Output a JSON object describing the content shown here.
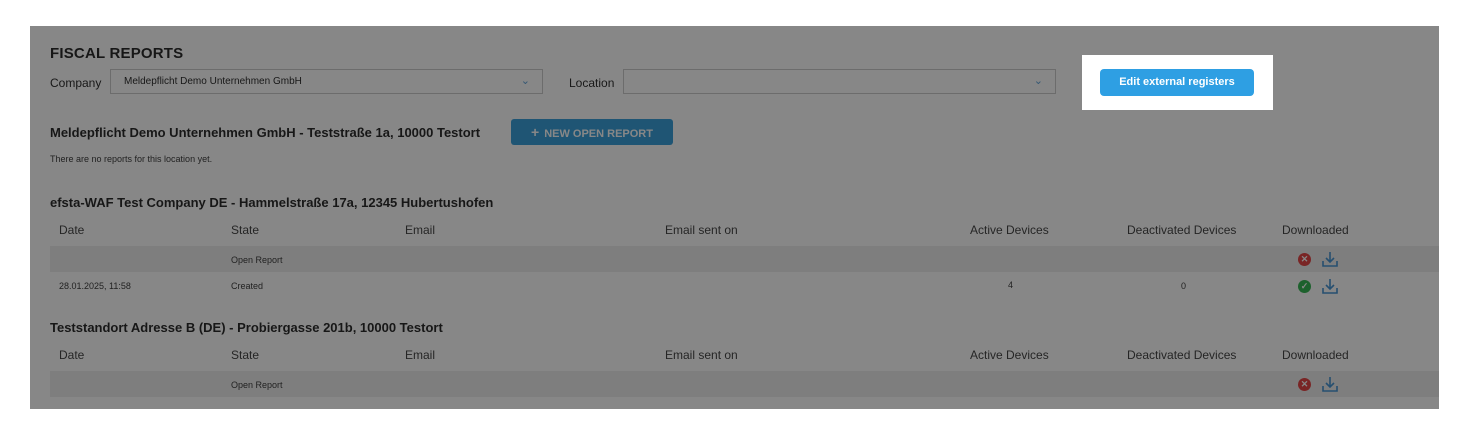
{
  "page": {
    "title": "FISCAL REPORTS"
  },
  "filters": {
    "company_label": "Company",
    "company_value": "Meldepflicht Demo Unternehmen GmbH",
    "location_label": "Location",
    "location_value": "",
    "edit_button": "Edit external registers"
  },
  "sections": [
    {
      "heading": "Meldepflicht Demo Unternehmen GmbH - Teststraße 1a, 10000 Testort",
      "new_button": "NEW OPEN REPORT",
      "empty_text": "There are no reports for this location yet."
    },
    {
      "heading": "efsta-WAF Test Company DE - Hammelstraße 17a, 12345 Hubertushofen",
      "columns": [
        "Date",
        "State",
        "Email",
        "Email sent on",
        "Active Devices",
        "Deactivated Devices",
        "Downloaded"
      ],
      "rows": [
        {
          "date": "",
          "state": "Open Report",
          "email": "",
          "email_sent_on": "",
          "active": "",
          "deactivated": "",
          "downloaded": "no"
        },
        {
          "date": "28.01.2025, 11:58",
          "state": "Created",
          "email": "",
          "email_sent_on": "",
          "active": "4",
          "deactivated": "0",
          "downloaded": "yes"
        }
      ]
    },
    {
      "heading": "Teststandort Adresse B (DE) - Probiergasse 201b, 10000 Testort",
      "columns": [
        "Date",
        "State",
        "Email",
        "Email sent on",
        "Active Devices",
        "Deactivated Devices",
        "Downloaded"
      ],
      "rows": [
        {
          "date": "",
          "state": "Open Report",
          "email": "",
          "email_sent_on": "",
          "active": "",
          "deactivated": "",
          "downloaded": "no"
        }
      ]
    }
  ],
  "colors": {
    "accent": "#2e9fe3",
    "error": "#e23a3a",
    "success": "#2bb34a",
    "overlay": "rgba(15,15,15,0.5)"
  },
  "icons": {
    "not_downloaded": "x-circle-icon",
    "downloaded": "check-circle-icon",
    "download": "download-icon",
    "add": "plus-icon",
    "dropdown": "chevron-down-icon"
  }
}
